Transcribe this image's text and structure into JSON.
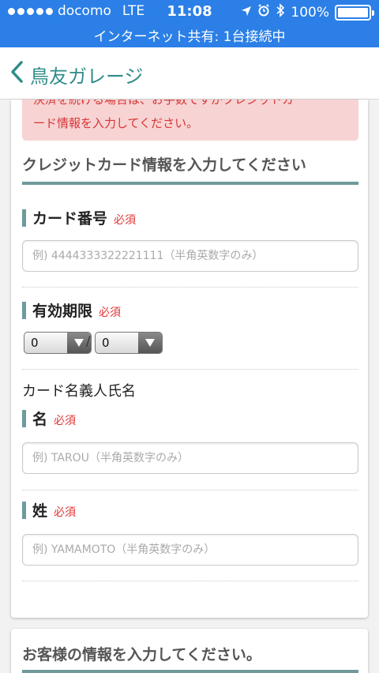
{
  "status_bar": {
    "carrier": "docomo",
    "network": "LTE",
    "time": "11:08",
    "battery": "100%",
    "battery_level": 1.0,
    "hotspot": "インターネット共有: 1台接続中"
  },
  "nav": {
    "title": "鳥友ガレージ"
  },
  "alert": {
    "line1": "決済を続ける場合は、お手数ですがクレジットカ",
    "line2": "ード情報を入力してください。"
  },
  "credit_section": {
    "title": "クレジットカード情報を入力してください",
    "card_number_label": "カード番号",
    "card_number_placeholder": "例) 4444333322221111（半角英数字のみ）",
    "expiry_label": "有効期限",
    "expiry_month": "0",
    "expiry_year": "0",
    "separator": "/",
    "holder_label": "カード名義人氏名",
    "first_name_label": "名",
    "first_name_placeholder": "例) TAROU（半角英数字のみ）",
    "last_name_label": "姓",
    "last_name_placeholder": "例) YAMAMOTO（半角英数字のみ）",
    "required": "必須"
  },
  "customer_section": {
    "title": "お客様の情報を入力してください。"
  },
  "colors": {
    "status_blue": "#2b7fe6",
    "accent_teal": "#2f8c88",
    "rule_teal": "#6f9a9b",
    "alert_bg": "#f8d3d3",
    "alert_text": "#d63636",
    "required_red": "#e03434"
  },
  "icons": {
    "back": "chevron-left-icon",
    "location": "location-arrow-icon",
    "alarm": "alarm-clock-icon",
    "bluetooth": "bluetooth-icon",
    "battery": "battery-icon",
    "dropdown": "triangle-down-icon"
  }
}
